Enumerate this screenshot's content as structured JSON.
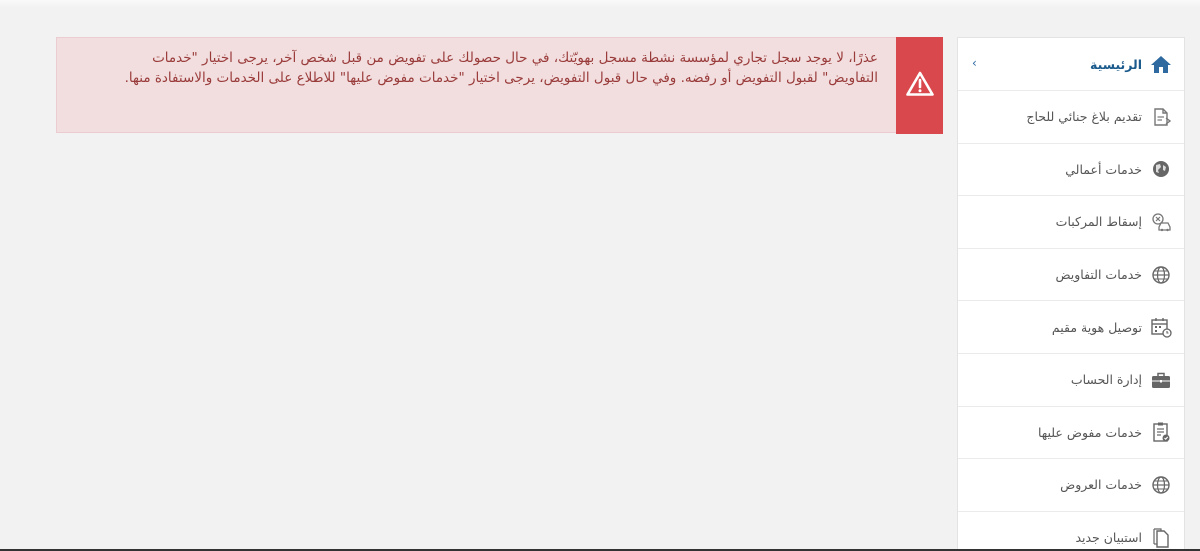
{
  "alert": {
    "icon": "warning-triangle-icon",
    "message": "عذرًا، لا يوجد سجل تجاري لمؤسسة نشطة مسجل بهويّتك، في حال حصولك على تفويض من قبل شخص آخر، يرجى اختيار \"خدمات التفاويض\" لقبول التفويض أو رفضه. وفي حال قبول التفويض، يرجى اختيار \"خدمات مفوض عليها\" للاطلاع على الخدمات والاستفادة منها.",
    "bg_color": "#f2dede",
    "icon_bg_color": "#d9484d",
    "text_color": "#9a3b3b"
  },
  "sidebar": {
    "items": [
      {
        "label": "الرئيسية",
        "icon": "home-icon",
        "active": true
      },
      {
        "label": "تقديم بلاغ جنائي للحاج",
        "icon": "document-edit-icon"
      },
      {
        "label": "خدمات أعمالي",
        "icon": "globe-business-icon"
      },
      {
        "label": "إسقاط المركبات",
        "icon": "car-remove-icon"
      },
      {
        "label": "خدمات التفاويض",
        "icon": "globe-icon"
      },
      {
        "label": "توصيل هوية مقيم",
        "icon": "calendar-clock-icon"
      },
      {
        "label": "إدارة الحساب",
        "icon": "briefcase-icon"
      },
      {
        "label": "خدمات مفوض عليها",
        "icon": "clipboard-check-icon"
      },
      {
        "label": "خدمات العروض",
        "icon": "globe-icon"
      },
      {
        "label": "استبيان جديد",
        "icon": "copy-document-icon"
      }
    ],
    "collapse_icon": "chevron-left-icon",
    "active_color": "#1a5a8c"
  }
}
